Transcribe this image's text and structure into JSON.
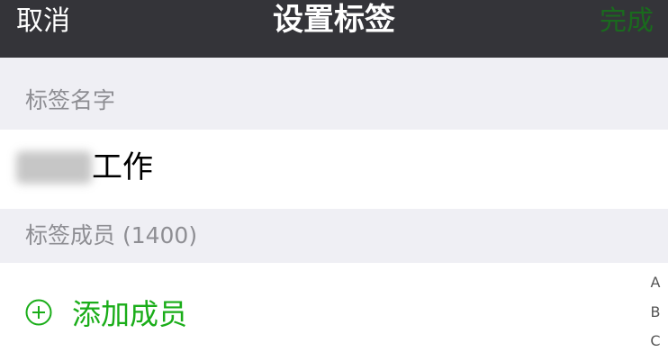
{
  "navbar": {
    "cancel_label": "取消",
    "title": "设置标签",
    "done_label": "完成"
  },
  "name_section": {
    "header": "标签名字",
    "value": "工作"
  },
  "members_section": {
    "header": "标签成员 (1400)",
    "add_label": "添加成员"
  },
  "index_bar": {
    "letters": [
      "A",
      "B",
      "C"
    ]
  },
  "colors": {
    "navbar_bg": "#343439",
    "accent_green": "#1aad19",
    "done_disabled": "#1a6a1e",
    "section_text": "#8e8e93"
  },
  "icons": {
    "add": "plus-circle-icon"
  }
}
